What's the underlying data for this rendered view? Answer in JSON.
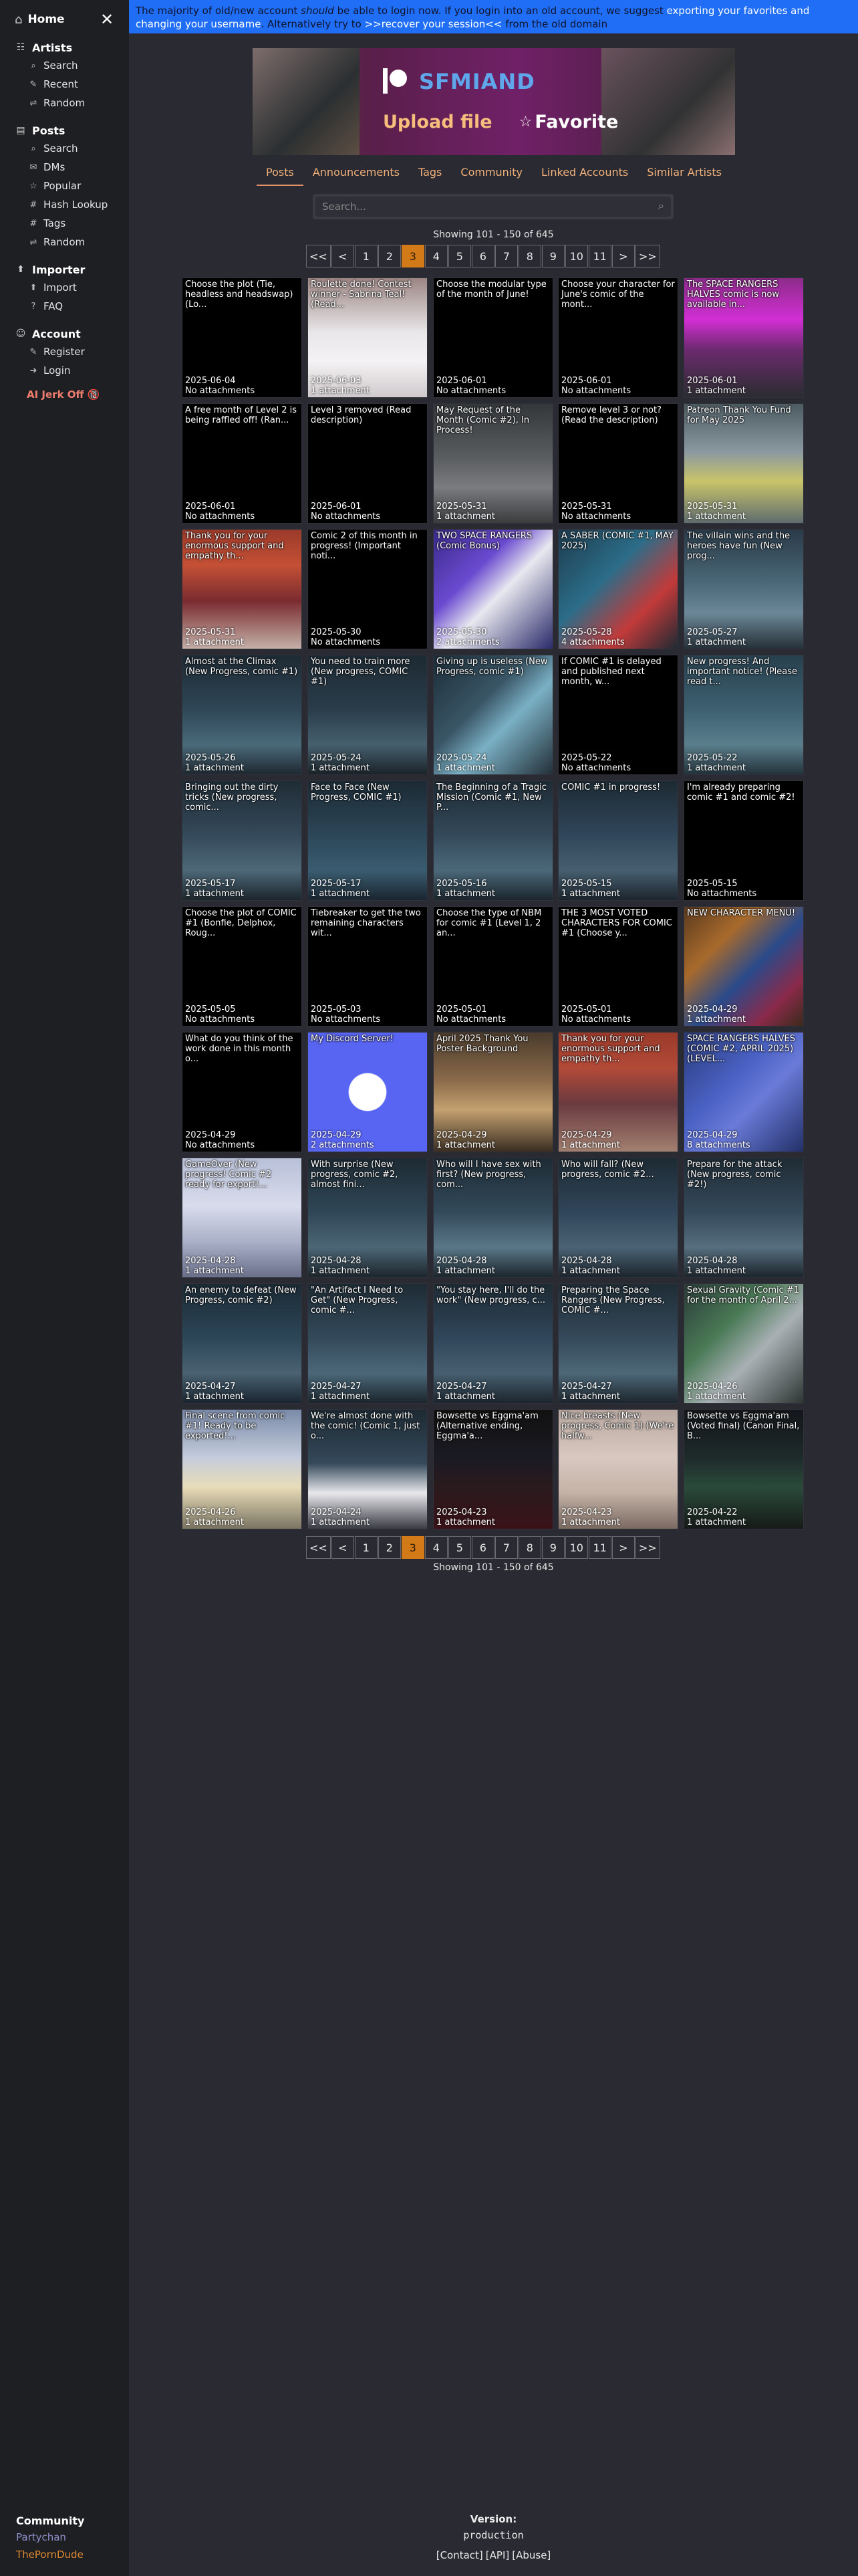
{
  "sidebar": {
    "home": "Home",
    "sections": [
      {
        "name": "sb-artists",
        "title": "Artists",
        "icon": "☷",
        "items": [
          {
            "label": "Search",
            "icon": "⌕"
          },
          {
            "label": "Recent",
            "icon": "✎"
          },
          {
            "label": "Random",
            "icon": "⇌"
          }
        ]
      },
      {
        "name": "sb-posts",
        "title": "Posts",
        "icon": "▤",
        "items": [
          {
            "label": "Search",
            "icon": "⌕"
          },
          {
            "label": "DMs",
            "icon": "✉"
          },
          {
            "label": "Popular",
            "icon": "☆"
          },
          {
            "label": "Hash Lookup",
            "icon": "#"
          },
          {
            "label": "Tags",
            "icon": "#"
          },
          {
            "label": "Random",
            "icon": "⇌"
          }
        ]
      },
      {
        "name": "sb-importer",
        "title": "Importer",
        "icon": "⬆",
        "items": [
          {
            "label": "Import",
            "icon": "⬆"
          },
          {
            "label": "FAQ",
            "icon": "?"
          }
        ]
      },
      {
        "name": "sb-account",
        "title": "Account",
        "icon": "☺",
        "items": [
          {
            "label": "Register",
            "icon": "✎"
          },
          {
            "label": "Login",
            "icon": "➜"
          }
        ]
      }
    ],
    "jerk": "AI Jerk Off 🔞",
    "community": {
      "title": "Community",
      "partychan": "Partychan",
      "porndude": "ThePornDude"
    }
  },
  "banner": {
    "a": "The majority of old/new account ",
    "b": "should",
    "c": " be able to login now. If you login into an old account, we suggest ",
    "d": "exporting your favorites and changing your username",
    "e": ". Alternatively try to ",
    "f": ">>recover your session<<",
    "g": " from the old domain"
  },
  "artist": {
    "name": "SFMIAND",
    "upload": "Upload file",
    "favorite": "Favorite"
  },
  "tabs": [
    "Posts",
    "Announcements",
    "Tags",
    "Community",
    "Linked Accounts",
    "Similar Artists"
  ],
  "search": {
    "placeholder": "Search..."
  },
  "showing": "Showing 101 - 150 of 645",
  "pagination": [
    "<<",
    "<",
    "1",
    "2",
    "3",
    "4",
    "5",
    "6",
    "7",
    "8",
    "9",
    "10",
    "11",
    ">",
    ">>"
  ],
  "posts": [
    {
      "title": "Choose the plot (Tie, headless and headswap) (Lo...",
      "date": "2025-06-04",
      "att": "No attachments",
      "art": ""
    },
    {
      "title": "Roulette done! Contest winner - Sabrina Teal! (Read...",
      "date": "2025-06-03",
      "att": "1 attachment",
      "art": "linear-gradient(180deg,#9c8583 0%,#e8e6e8 45%,#f4f2f4 70%,#cfc9cc 100%)"
    },
    {
      "title": "Choose the modular type of the month of June!",
      "date": "2025-06-01",
      "att": "No attachments",
      "art": ""
    },
    {
      "title": "Choose your character for June's comic of the mont...",
      "date": "2025-06-01",
      "att": "No attachments",
      "art": ""
    },
    {
      "title": "The SPACE RANGERS HALVES comic is now available in...",
      "date": "2025-06-01",
      "att": "1 attachment",
      "art": "linear-gradient(180deg,#8d2c8a 0%,#d22ed4 35%,#6c2a6e 60%,#2a2d30 100%)"
    },
    {
      "title": "A free month of Level 2 is being raffled off! (Ran...",
      "date": "2025-06-01",
      "att": "No attachments",
      "art": ""
    },
    {
      "title": "Level 3 removed (Read description)",
      "date": "2025-06-01",
      "att": "No attachments",
      "art": ""
    },
    {
      "title": "May Request of the Month (Comic #2), In Process!",
      "date": "2025-05-31",
      "att": "1 attachment",
      "art": "linear-gradient(180deg,#34373a 0%,#5a5d60 45%,#7a7c7f 70%,#3a3c3e 100%)"
    },
    {
      "title": "Remove level 3 or not? (Read the description)",
      "date": "2025-05-31",
      "att": "No attachments",
      "art": ""
    },
    {
      "title": "Patreon Thank You Fund for May 2025",
      "date": "2025-05-31",
      "att": "1 attachment",
      "art": "linear-gradient(180deg,#4c5a62 0%,#8a98a0 40%,#c9c46a 65%,#5f6c6e 100%)"
    },
    {
      "title": "Thank you for your enormous support and empathy th...",
      "date": "2025-05-31",
      "att": "1 attachment",
      "art": "linear-gradient(180deg,#9a3a2a 0%,#c45035 30%,#7a2b30 60%,#c4b0a8 100%)"
    },
    {
      "title": "Comic 2 of this month in progress! (Important noti...",
      "date": "2025-05-30",
      "att": "No attachments",
      "art": ""
    },
    {
      "title": "TWO SPACE RANGERS (Comic Bonus)",
      "date": "2025-05-30",
      "att": "2 attachments",
      "art": "linear-gradient(135deg,#3a2a8a 0%,#6a4ad0 35%,#e8e8f0 55%,#2a2a6a 100%)"
    },
    {
      "title": "A SABER (COMIC #1, MAY 2025)",
      "date": "2025-05-28",
      "att": "4 attachments",
      "art": "linear-gradient(135deg,#1d3b4e 0%,#2c6d88 40%,#c23a3a 70%,#1e2a33 100%)"
    },
    {
      "title": "The villain wins and the heroes have fun (New prog...",
      "date": "2025-05-27",
      "att": "1 attachment",
      "art": "linear-gradient(180deg,#2a3a48 0%,#4a6878 45%,#6c8898 70%,#263038 100%)"
    },
    {
      "title": "Almost at the Climax (New Progress, comic #1)",
      "date": "2025-05-26",
      "att": "1 attachment",
      "art": "linear-gradient(180deg,#1e2a33 0%,#2e4656 45%,#4a6a7a 75%,#1e2830 100%)"
    },
    {
      "title": "You need to train more (New progress, COMIC #1)",
      "date": "2025-05-24",
      "att": "1 attachment",
      "art": "linear-gradient(180deg,#1d2a33 0%,#2a3c4a 45%,#46606e 75%,#1a2228 100%)"
    },
    {
      "title": "Giving up is useless (New Progress, comic #1)",
      "date": "2025-05-24",
      "att": "1 attachment",
      "art": "linear-gradient(135deg,#1c2d38 0%,#3a5666 40%,#7ab0c4 60%,#233038 100%)"
    },
    {
      "title": "If COMIC #1 is delayed and published next month, w...",
      "date": "2025-05-22",
      "att": "No attachments",
      "art": ""
    },
    {
      "title": "New progress! And important notice! (Please read t...",
      "date": "2025-05-22",
      "att": "1 attachment",
      "art": "linear-gradient(180deg,#28404e 0%,#3d6070 45%,#5a7e8c 75%,#23323a 100%)"
    },
    {
      "title": "Bringing out the dirty tricks (New progress, comic...",
      "date": "2025-05-17",
      "att": "1 attachment",
      "art": "linear-gradient(180deg,#1f2c35 0%,#34495a 45%,#4d6878 75%,#1c252c 100%)"
    },
    {
      "title": "Face to Face (New Progress, COMIC #1)",
      "date": "2025-05-17",
      "att": "1 attachment",
      "art": "linear-gradient(180deg,#1c2a34 0%,#2c4658 45%,#3a5c70 75%,#1a2530 100%)"
    },
    {
      "title": "The Beginning of a Tragic Mission (Comic #1, New P...",
      "date": "2025-05-16",
      "att": "1 attachment",
      "art": "linear-gradient(180deg,#1e2b34 0%,#33495a 45%,#4b6879 75%,#1b252c 100%)"
    },
    {
      "title": "COMIC #1 in progress!",
      "date": "2025-05-15",
      "att": "1 attachment",
      "art": "linear-gradient(180deg,#1d2a33 0%,#30465a 45%,#465f70 75%,#1c252d 100%)"
    },
    {
      "title": "I'm already preparing comic #1 and comic #2!",
      "date": "2025-05-15",
      "att": "No attachments",
      "art": ""
    },
    {
      "title": "Choose the plot of COMIC #1 (Bonfie, Delphox, Roug...",
      "date": "2025-05-05",
      "att": "No attachments",
      "art": ""
    },
    {
      "title": "Tiebreaker to get the two remaining characters wit...",
      "date": "2025-05-03",
      "att": "No attachments",
      "art": ""
    },
    {
      "title": "Choose the type of NBM for comic #1 (Level 1, 2 an...",
      "date": "2025-05-01",
      "att": "No attachments",
      "art": ""
    },
    {
      "title": "THE 3 MOST VOTED CHARACTERS FOR COMIC #1 (Choose y...",
      "date": "2025-05-01",
      "att": "No attachments",
      "art": ""
    },
    {
      "title": "NEW CHARACTER MENU!",
      "date": "2025-04-29",
      "att": "1 attachment",
      "art": "linear-gradient(135deg,#5a3a1e 0%,#a86a2c 30%,#2a4a8a 55%,#8a2a4a 80%,#3a2a1a 100%)"
    },
    {
      "title": "What do you think of the work done in this month o...",
      "date": "2025-04-29",
      "att": "No attachments",
      "art": ""
    },
    {
      "title": "My Discord Server!",
      "date": "2025-04-29",
      "att": "2 attachments",
      "art": "radial-gradient(circle at 50% 50%,#ffffff 0%,#ffffff 22%,#5865f2 23%,#5865f2 100%)"
    },
    {
      "title": "April 2025 Thank You Poster Background",
      "date": "2025-04-29",
      "att": "1 attachment",
      "art": "linear-gradient(180deg,#4a3b2c 0%,#8a6a4a 40%,#c4a070 65%,#3a2e22 100%)"
    },
    {
      "title": "Thank you for your enormous support and empathy th...",
      "date": "2025-04-29",
      "att": "1 attachment",
      "art": "linear-gradient(180deg,#9a3a2a 0%,#b24a38 30%,#6a3a40 60%,#a28070 100%)"
    },
    {
      "title": "SPACE RANGERS HALVES (COMIC #2, APRIL 2025) (LEVEL...",
      "date": "2025-04-29",
      "att": "8 attachments",
      "art": "linear-gradient(135deg,#2a3a7a 0%,#4a62c4 40%,#6a7ad8 60%,#223068 100%)"
    },
    {
      "title": "GameOver (New progress! Comic #2 ready for export!...",
      "date": "2025-04-28",
      "att": "1 attachment",
      "art": "linear-gradient(180deg,#b8c0d8 0%,#d8dcec 40%,#aab0c8 70%,#6a708a 100%)"
    },
    {
      "title": "With surprise (New progress, comic #2, almost fini...",
      "date": "2025-04-28",
      "att": "1 attachment",
      "art": "linear-gradient(180deg,#1d2a33 0%,#2f4656 45%,#4c6676 75%,#1c252c 100%)"
    },
    {
      "title": "Who will I have sex with first? (New progress, com...",
      "date": "2025-04-28",
      "att": "1 attachment",
      "art": "linear-gradient(180deg,#1e2b34 0%,#32495a 45%,#5a7888 75%,#1b252c 100%)"
    },
    {
      "title": "Who will fall? (New progress, comic #2...",
      "date": "2025-04-28",
      "att": "1 attachment",
      "art": "linear-gradient(180deg,#1d2a33 0%,#30465a 45%,#4a6274 75%,#1c252d 100%)"
    },
    {
      "title": "Prepare for the attack (New progress, comic #2!)",
      "date": "2025-04-28",
      "att": "1 attachment",
      "art": "linear-gradient(180deg,#1f2c35 0%,#34495a 45%,#566e7e 75%,#1c252c 100%)"
    },
    {
      "title": "An enemy to defeat (New Progress, comic #2)",
      "date": "2025-04-27",
      "att": "1 attachment",
      "art": "linear-gradient(180deg,#1c2a34 0%,#2c4658 45%,#4a6272 75%,#1a2530 100%)"
    },
    {
      "title": "\"An Artifact I Need to Get\" (New Progress, comic #...",
      "date": "2025-04-27",
      "att": "1 attachment",
      "art": "linear-gradient(180deg,#1e2b34 0%,#33495a 45%,#4b6879 75%,#1b252c 100%)"
    },
    {
      "title": "\"You stay here, I'll do the work\" (New progress, c...",
      "date": "2025-04-27",
      "att": "1 attachment",
      "art": "linear-gradient(180deg,#1d2a33 0%,#30465a 45%,#465f70 75%,#1c252d 100%)"
    },
    {
      "title": "Preparing the Space Rangers (New Progress, COMIC #...",
      "date": "2025-04-27",
      "att": "1 attachment",
      "art": "linear-gradient(180deg,#1f2c35 0%,#34495a 45%,#4d6878 75%,#1c252c 100%)"
    },
    {
      "title": "Sexual Gravity (Comic #1 for the month of April 2...",
      "date": "2025-04-26",
      "att": "1 attachment",
      "art": "linear-gradient(135deg,#2a3a38 0%,#4a7a56 35%,#a8b0b4 60%,#2e3634 100%)"
    },
    {
      "title": "Final scene from comic #1! Ready to be exported!...",
      "date": "2025-04-26",
      "att": "1 attachment",
      "art": "linear-gradient(180deg,#7a8aa8 0%,#c4ccdc 40%,#e8dcb8 65%,#7a7462 100%)"
    },
    {
      "title": "We're almost done with the comic! (Comic 1, just o...",
      "date": "2025-04-24",
      "att": "1 attachment",
      "art": "linear-gradient(180deg,#1d2a33 0%,#34495a 45%,#e8e8ec 70%,#3a3c44 100%)"
    },
    {
      "title": "Bowsette vs Eggma'am (Alternative ending, Eggma'a...",
      "date": "2025-04-23",
      "att": "1 attachment",
      "art": "linear-gradient(180deg,#111 0%,#1a1a22 40%,#2a1a1e 65%,#3a1218 100%)"
    },
    {
      "title": "Nice breasts (New progress, Comic 1) (We're halfw...",
      "date": "2025-04-23",
      "att": "1 attachment",
      "art": "linear-gradient(180deg,#b8a8a0 0%,#d8c8c0 40%,#c4b2a6 70%,#7a6a62 100%)"
    },
    {
      "title": "Bowsette vs Eggma'am (Voted final) (Canon Final, B...",
      "date": "2025-04-22",
      "att": "1 attachment",
      "art": "linear-gradient(180deg,#14161a 0%,#1e2a2a 40%,#2a4a3a 65%,#161a18 100%)"
    }
  ],
  "footer": {
    "version_label": "Version:",
    "version": "production",
    "links": [
      "[Contact]",
      "[API]",
      "[Abuse]"
    ]
  }
}
